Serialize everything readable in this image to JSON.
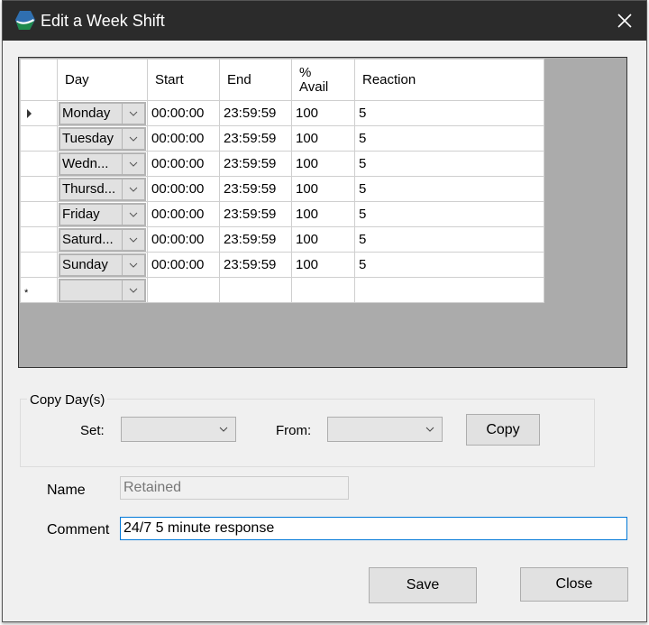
{
  "window": {
    "title": "Edit a Week Shift"
  },
  "grid": {
    "columns": [
      "Day",
      "Start",
      "End",
      "% Avail",
      "Reaction"
    ],
    "rows": [
      {
        "day": "Monday",
        "start": "00:00:00",
        "end": "23:59:59",
        "avail": "100",
        "reaction": "5"
      },
      {
        "day": "Tuesday",
        "start": "00:00:00",
        "end": "23:59:59",
        "avail": "100",
        "reaction": "5"
      },
      {
        "day": "Wedn...",
        "start": "00:00:00",
        "end": "23:59:59",
        "avail": "100",
        "reaction": "5"
      },
      {
        "day": "Thursd...",
        "start": "00:00:00",
        "end": "23:59:59",
        "avail": "100",
        "reaction": "5"
      },
      {
        "day": "Friday",
        "start": "00:00:00",
        "end": "23:59:59",
        "avail": "100",
        "reaction": "5"
      },
      {
        "day": "Saturd...",
        "start": "00:00:00",
        "end": "23:59:59",
        "avail": "100",
        "reaction": "5"
      },
      {
        "day": "Sunday",
        "start": "00:00:00",
        "end": "23:59:59",
        "avail": "100",
        "reaction": "5"
      }
    ],
    "new_row_marker": "*"
  },
  "copy": {
    "group_label": "Copy Day(s)",
    "set_label": "Set:",
    "from_label": "From:",
    "set_value": "",
    "from_value": "",
    "copy_button": "Copy"
  },
  "form": {
    "name_label": "Name",
    "name_value": "Retained",
    "comment_label": "Comment",
    "comment_value": "24/7 5 minute response"
  },
  "buttons": {
    "save": "Save",
    "close": "Close"
  }
}
